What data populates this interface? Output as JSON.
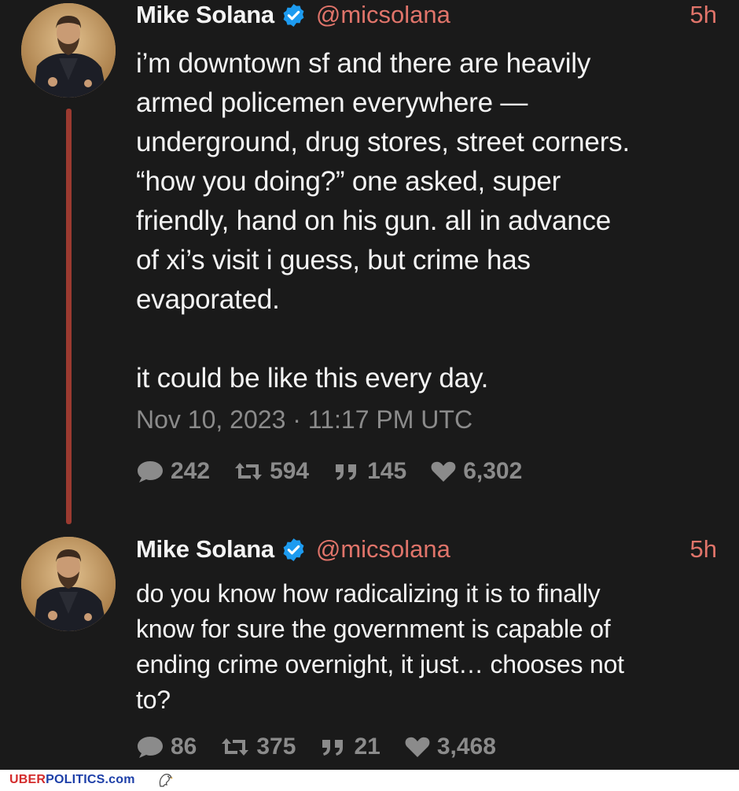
{
  "tweets": [
    {
      "author": {
        "display_name": "Mike Solana",
        "handle": "@micsolana",
        "verified": true,
        "avatar_icon": "portrait-avatar"
      },
      "time_ago": "5h",
      "text": "i’m downtown sf and there are heavily\narmed policemen everywhere —\nunderground, drug stores, street corners.\n“how you doing?” one asked, super\nfriendly, hand on his gun. all in advance\nof xi’s visit i guess, but crime has\nevaporated.\n\nit could be like this every day.",
      "timestamp": "Nov 10, 2023 · 11:17 PM UTC",
      "stats": {
        "replies": "242",
        "retweets": "594",
        "quotes": "145",
        "likes": "6,302"
      }
    },
    {
      "author": {
        "display_name": "Mike Solana",
        "handle": "@micsolana",
        "verified": true,
        "avatar_icon": "portrait-avatar"
      },
      "time_ago": "5h",
      "text": "do you know how radicalizing it is to finally\nknow for sure the government is capable of\nending crime overnight, it just… chooses not\nto?",
      "stats": {
        "replies": "86",
        "retweets": "375",
        "quotes": "21",
        "likes": "3,468"
      }
    }
  ],
  "footer": {
    "brand_red": "UBER",
    "brand_blue": "POLITICS.com",
    "icon": "eagle-icon"
  },
  "colors": {
    "background": "#1a1a1a",
    "accent": "#e0746a",
    "thread_line": "#9b3a30",
    "muted": "#8b8b8b",
    "verified": "#1d9bf0"
  }
}
